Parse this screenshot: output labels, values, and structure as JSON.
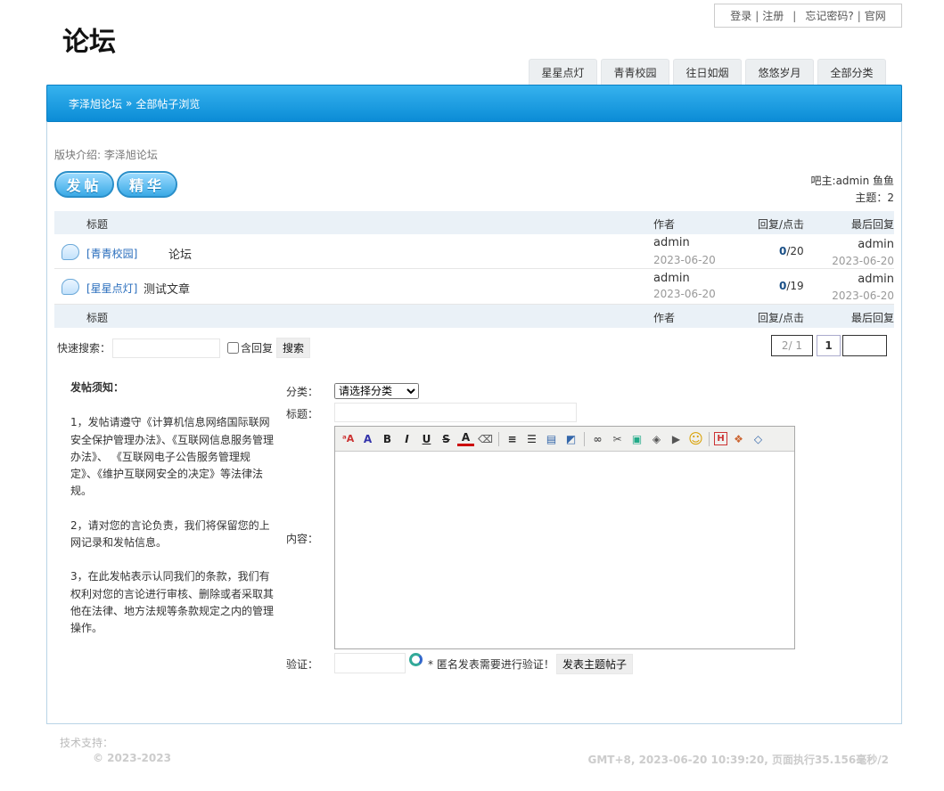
{
  "toplinks": {
    "login": "登录",
    "register": "注册",
    "forgot": "忘记密码?",
    "official": "官网",
    "sep": "|"
  },
  "logo": "论坛",
  "tabs": [
    "星星点灯",
    "青青校园",
    "往日如烟",
    "悠悠岁月",
    "全部分类"
  ],
  "breadcrumb": {
    "forum": "李泽旭论坛",
    "arrow": "»",
    "current": "全部帖子浏览"
  },
  "intro": "版块介绍: 李泽旭论坛",
  "buttons": {
    "post": "发帖",
    "digest": "精华"
  },
  "owner": {
    "label": "吧主:admin 鱼鱼",
    "topics": "主题：2"
  },
  "table": {
    "headers": {
      "title": "标题",
      "author": "作者",
      "replies": "回复/点击",
      "last": "最后回复"
    },
    "rows": [
      {
        "category": "[青青校园]",
        "title": "论坛",
        "author": "admin",
        "date": "2023-06-20",
        "replies": "0",
        "clicks": "/20",
        "last_user": "admin",
        "last_date": "2023-06-20"
      },
      {
        "category": "[星星点灯]",
        "title": "测试文章",
        "author": "admin",
        "date": "2023-06-20",
        "replies": "0",
        "clicks": "/19",
        "last_user": "admin",
        "last_date": "2023-06-20"
      }
    ]
  },
  "search": {
    "label": "快速搜索：",
    "include_replies": "含回复",
    "button": "搜索",
    "value": ""
  },
  "pagination": {
    "info": "2/ 1",
    "current": "1",
    "goto": ""
  },
  "notice": {
    "title": "发帖须知：",
    "items": [
      "1，发帖请遵守《计算机信息网络国际联网安全保护管理办法》、《互联网信息服务管理办法》、 《互联网电子公告服务管理规定》、《维护互联网安全的决定》等法律法规。",
      "2，请对您的言论负责，我们将保留您的上网记录和发帖信息。",
      "3，在此发帖表示认同我们的条款，我们有权利对您的言论进行审核、删除或者采取其他在法律、地方法规等条款规定之内的管理操作。"
    ]
  },
  "form": {
    "category_label": "分类：",
    "category_selected": "请选择分类",
    "title_label": "标题：",
    "content_label": "内容：",
    "verify_label": "验证：",
    "verify_hint": "* 匿名发表需要进行验证！",
    "submit": "发表主题帖子"
  },
  "footer": {
    "support": "技术支持：",
    "copyright": "© 2023-2023",
    "status": "GMT+8, 2023-06-20 10:39:20, 页面执行35.156毫秒/2"
  }
}
